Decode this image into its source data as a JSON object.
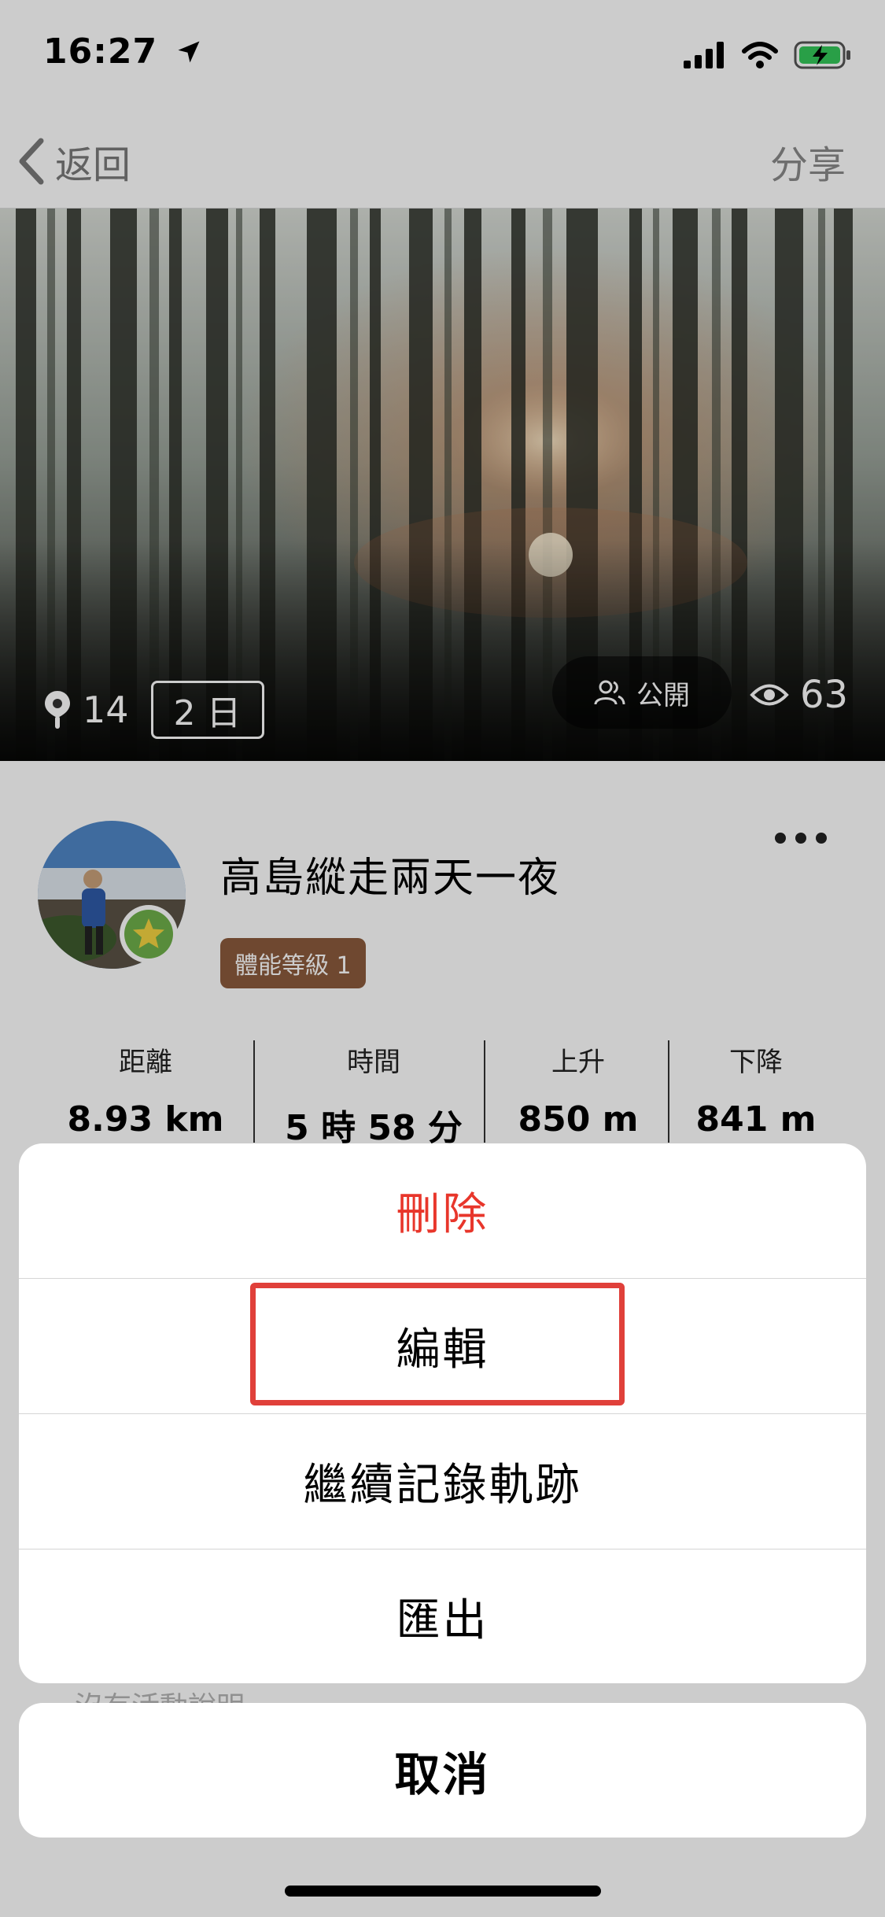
{
  "status_bar": {
    "time": "16:27",
    "icons": [
      "location-arrow-icon",
      "cellular-signal-icon",
      "wifi-icon",
      "battery-charging-icon"
    ]
  },
  "nav": {
    "back_label": "返回",
    "share_label": "分享"
  },
  "hero": {
    "photo_count": "14",
    "days_badge": "2 日",
    "visibility": "公開",
    "views": "63"
  },
  "activity": {
    "title": "高島縱走兩天一夜",
    "level_badge": "體能等級 1",
    "stats": [
      {
        "label": "距離",
        "value": "8.93 km"
      },
      {
        "label": "時間",
        "value": "5 時 58 分"
      },
      {
        "label": "上升",
        "value": "850 m"
      },
      {
        "label": "下降",
        "value": "841 m"
      }
    ],
    "description": "沒有活動說明"
  },
  "action_sheet": {
    "items": [
      {
        "label": "刪除",
        "style": "destructive"
      },
      {
        "label": "編輯",
        "style": "default"
      },
      {
        "label": "繼續記錄軌跡",
        "style": "default"
      },
      {
        "label": "匯出",
        "style": "default"
      }
    ],
    "cancel_label": "取消"
  },
  "colors": {
    "destructive": "#e8362b",
    "highlight_box": "#e0403a",
    "level_badge": "#8b5a3c"
  }
}
